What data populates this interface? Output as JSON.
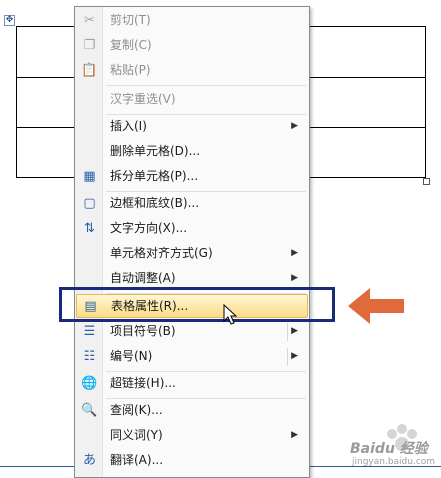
{
  "menu": {
    "items": [
      {
        "label": "剪切(T)",
        "icon": "scissors-icon",
        "enabled": false
      },
      {
        "label": "复制(C)",
        "icon": "copy-icon",
        "enabled": false
      },
      {
        "label": "粘贴(P)",
        "icon": "paste-icon",
        "enabled": false
      },
      {
        "label": "汉字重选(V)",
        "enabled": false
      },
      {
        "label": "插入(I)",
        "submenu": true
      },
      {
        "label": "删除单元格(D)..."
      },
      {
        "label": "拆分单元格(P)...",
        "icon": "split-cells-icon"
      },
      {
        "label": "边框和底纹(B)...",
        "icon": "borders-icon"
      },
      {
        "label": "文字方向(X)...",
        "icon": "text-direction-icon"
      },
      {
        "label": "单元格对齐方式(G)",
        "submenu": true
      },
      {
        "label": "自动调整(A)",
        "submenu": true
      },
      {
        "label": "表格属性(R)...",
        "icon": "table-properties-icon",
        "highlighted": true
      },
      {
        "label": "项目符号(B)",
        "icon": "bullets-icon",
        "submenu": true
      },
      {
        "label": "编号(N)",
        "icon": "numbering-icon",
        "submenu": true
      },
      {
        "label": "超链接(H)...",
        "icon": "hyperlink-icon"
      },
      {
        "label": "查阅(K)...",
        "icon": "research-icon"
      },
      {
        "label": "同义词(Y)",
        "submenu": true
      },
      {
        "label": "翻译(A)...",
        "icon": "translate-icon"
      }
    ]
  },
  "watermark": {
    "text": "Baidu 经验",
    "sub": "jingyan.baidu.com"
  },
  "colors": {
    "highlight_box": "#1a2a7a",
    "arrow": "#e06a3a"
  }
}
